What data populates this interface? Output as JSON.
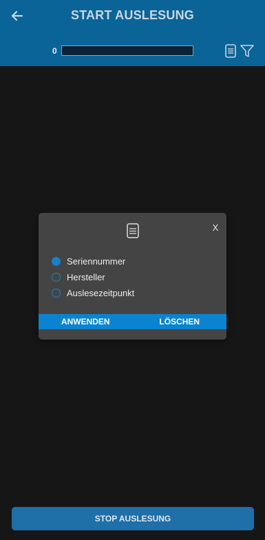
{
  "header": {
    "title": "START AUSLESUNG",
    "count": "0",
    "progress_fraction": 0
  },
  "icons": {
    "back": "arrow-left-icon",
    "list": "list-icon",
    "filter": "filter-icon",
    "dialog": "list-icon"
  },
  "dialog": {
    "close_label": "X",
    "options": [
      {
        "label": "Seriennummer",
        "selected": true
      },
      {
        "label": "Hersteller",
        "selected": false
      },
      {
        "label": "Auslesezeitpunkt",
        "selected": false
      }
    ],
    "apply_label": "ANWENDEN",
    "clear_label": "LÖSCHEN"
  },
  "footer": {
    "stop_label": "STOP AUSLESUNG"
  },
  "colors": {
    "header_bg": "#0b6498",
    "accent": "#0a84d0",
    "dialog_bg": "#444444",
    "background": "#161616"
  }
}
